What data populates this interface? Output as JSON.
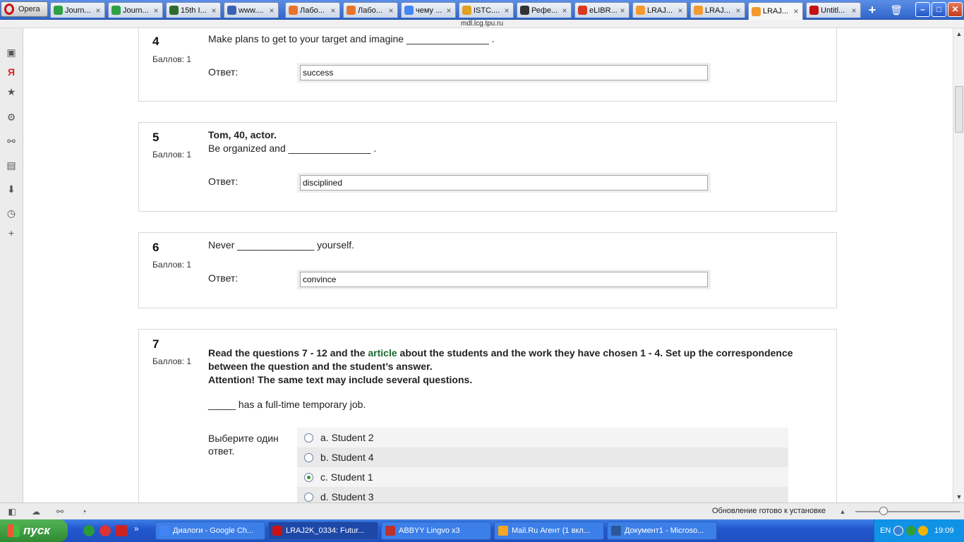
{
  "browser": {
    "menu_label": "Opera",
    "url": "mdl.lcg.tpu.ru",
    "tabs": [
      {
        "label": "Journ...",
        "icon": "green-circle-icon",
        "color": "#2ea043"
      },
      {
        "label": "Journ...",
        "icon": "green-circle-icon",
        "color": "#2ea043"
      },
      {
        "label": "15th I...",
        "icon": "leaf-icon",
        "color": "#2f6b2f"
      },
      {
        "label": "www....",
        "icon": "bar-chart-icon",
        "color": "#3a62b3"
      },
      {
        "label": "Лабо...",
        "icon": "orange-circle-icon",
        "color": "#e8742c"
      },
      {
        "label": "Лабо...",
        "icon": "orange-circle-icon",
        "color": "#e8742c"
      },
      {
        "label": "чему ...",
        "icon": "google-icon",
        "color": "#4285f4"
      },
      {
        "label": "ISTC....",
        "icon": "istc-icon",
        "color": "#e0a020"
      },
      {
        "label": "Рефе...",
        "icon": "graduation-cap-icon",
        "color": "#333333"
      },
      {
        "label": "eLIBR...",
        "icon": "elibrary-icon",
        "color": "#d9381e"
      },
      {
        "label": "LRAJ...",
        "icon": "moodle-icon",
        "color": "#f29a2e"
      },
      {
        "label": "LRAJ...",
        "icon": "moodle-icon",
        "color": "#f29a2e"
      },
      {
        "label": "LRAJ...",
        "icon": "moodle-icon",
        "color": "#f29a2e"
      },
      {
        "label": "Untitl...",
        "icon": "red-u-icon",
        "color": "#c41212"
      }
    ],
    "active_tab_index": 12,
    "add_tab_symbol": "+",
    "status_update": "Обновление готово к установке"
  },
  "quiz": {
    "grade_label": "Баллов: 1",
    "answer_label": "Ответ:",
    "choose_label_line1": "Выберите один",
    "choose_label_line2": "ответ.",
    "questions": [
      {
        "number": "4",
        "text": "Make plans to get to your target and imagine _______________ .",
        "answer": "success"
      },
      {
        "number": "5",
        "title": "Tom, 40, actor.",
        "text": "Be organized and _______________ .",
        "answer": "disciplined"
      },
      {
        "number": "6",
        "text": "Never ______________ yourself.",
        "answer": "convince"
      }
    ],
    "q7": {
      "number": "7",
      "instr_part1": "Read the questions 7 - 12 and the ",
      "instr_link": "article",
      "instr_part2": " about the students and the work they have chosen 1 - 4. Set up the correspondence between the question and the student’s answer.",
      "instr_line3": "Attention! The same text may include several questions.",
      "prompt": "_____ has a full-time temporary job.",
      "options": [
        {
          "label": "a. Student 2",
          "selected": false
        },
        {
          "label": "b. Student 4",
          "selected": false
        },
        {
          "label": "c. Student 1",
          "selected": true
        },
        {
          "label": "d. Student 3",
          "selected": false
        }
      ]
    }
  },
  "taskbar": {
    "start_label": "пуск",
    "tasks": [
      {
        "label": "Диалоги - Google Ch...",
        "color": "#4285f4"
      },
      {
        "label": "LRAJ2K_0334: Futur...",
        "color": "#cc1111"
      },
      {
        "label": "ABBYY Lingvo x3",
        "color": "#c0302a"
      },
      {
        "label": "Mail.Ru Агент (1 вкл...",
        "color": "#f5a623"
      },
      {
        "label": "Документ1 - Microso...",
        "color": "#2b579a"
      }
    ],
    "lang": "EN",
    "clock": "19:09"
  }
}
